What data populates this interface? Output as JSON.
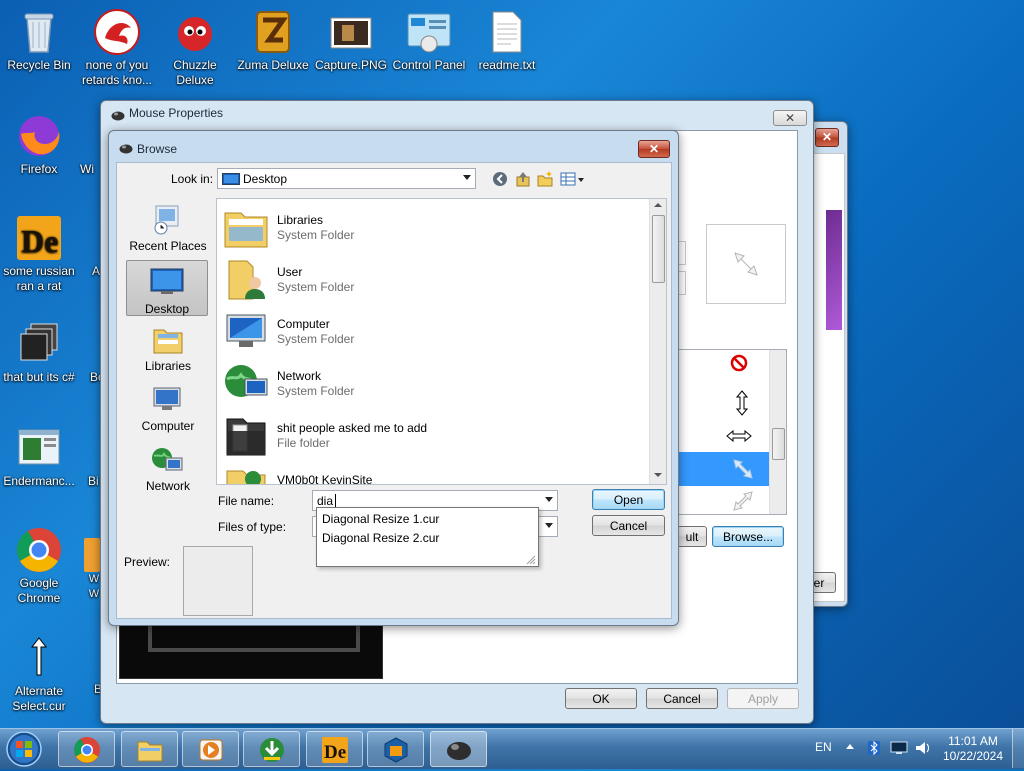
{
  "desktop_icons": [
    {
      "label": "Recycle Bin"
    },
    {
      "label": "none of you retards kno..."
    },
    {
      "label": "Chuzzle Deluxe"
    },
    {
      "label": "Zuma Deluxe"
    },
    {
      "label": "Capture.PNG"
    },
    {
      "label": "Control Panel"
    },
    {
      "label": "readme.txt"
    },
    {
      "label": "Firefox"
    },
    {
      "label": "Wi"
    },
    {
      "label": "some russian ran a rat"
    },
    {
      "label": "A"
    },
    {
      "label": "that but its c#"
    },
    {
      "label": "Bo"
    },
    {
      "label": "Endermanc..."
    },
    {
      "label": "Bi"
    },
    {
      "label": "Google Chrome"
    },
    {
      "label": "W W"
    },
    {
      "label": "Alternate Select.cur"
    },
    {
      "label": "B"
    }
  ],
  "mouse_properties": {
    "title": "Mouse Properties",
    "close": "✕",
    "ok": "OK",
    "cancel": "Cancel",
    "apply": "Apply",
    "use_default_fragment": "ult",
    "browse": "Browse...",
    "other_fragment": "er"
  },
  "browse": {
    "title": "Browse",
    "close": "✕",
    "look_in_label": "Look in:",
    "look_in_value": "Desktop",
    "places": [
      {
        "label": "Recent Places"
      },
      {
        "label": "Desktop"
      },
      {
        "label": "Libraries"
      },
      {
        "label": "Computer"
      },
      {
        "label": "Network"
      }
    ],
    "files": [
      {
        "name": "Libraries",
        "type": "System Folder"
      },
      {
        "name": "User",
        "type": "System Folder"
      },
      {
        "name": "Computer",
        "type": "System Folder"
      },
      {
        "name": "Network",
        "type": "System Folder"
      },
      {
        "name": "shit people asked me to add",
        "type": "File folder"
      },
      {
        "name": "VM0b0t KevinSite",
        "type": ""
      }
    ],
    "file_name_label": "File name:",
    "file_name_value": "dia",
    "files_of_type_label": "Files of type:",
    "open": "Open",
    "cancel": "Cancel",
    "preview_label": "Preview:",
    "autocomplete": [
      "Diagonal Resize 1.cur",
      "Diagonal Resize 2.cur"
    ]
  },
  "tray": {
    "lang": "EN",
    "time": "11:01 AM",
    "date": "10/22/2024"
  }
}
